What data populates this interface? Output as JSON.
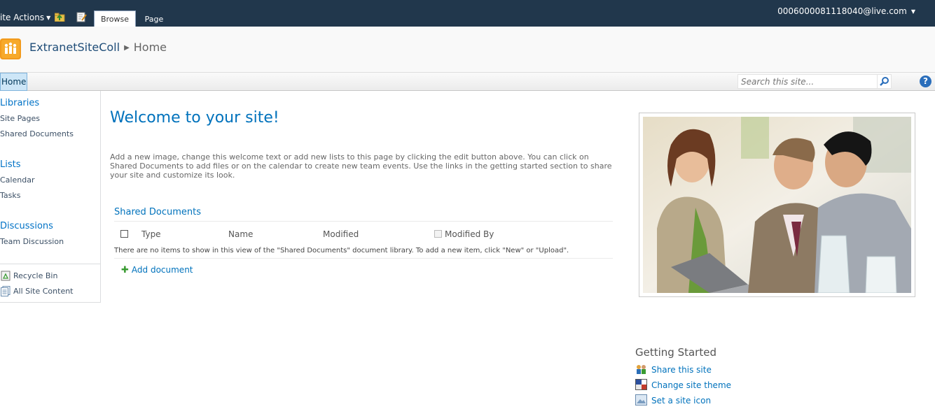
{
  "ribbon": {
    "site_actions": "ite Actions",
    "tabs": [
      "Browse",
      "Page"
    ],
    "user": "0006000081118040@live.com"
  },
  "title_area": {
    "site_title": "ExtranetSiteColl",
    "current_page": "Home"
  },
  "topnav": {
    "home": "Home",
    "search_placeholder": "Search this site...",
    "help": "?"
  },
  "quick_launch": {
    "libraries_heading": "Libraries",
    "libraries": [
      "Site Pages",
      "Shared Documents"
    ],
    "lists_heading": "Lists",
    "lists": [
      "Calendar",
      "Tasks"
    ],
    "discussions_heading": "Discussions",
    "discussions": [
      "Team Discussion"
    ],
    "recycle_bin": "Recycle Bin",
    "all_site_content": "All Site Content"
  },
  "main": {
    "welcome_title": "Welcome to your site!",
    "welcome_text": "Add a new image, change this welcome text or add new lists to this page by clicking the edit button above. You can click on Shared Documents to add files or on the calendar to create new team events. Use the links in the getting started section to share your site and customize its look.",
    "webpart_title": "Shared Documents",
    "columns": [
      "Type",
      "Name",
      "Modified",
      "Modified By"
    ],
    "empty_message": "There are no items to show in this view of the \"Shared Documents\" document library. To add a new item, click \"New\" or \"Upload\".",
    "add_document": "Add document"
  },
  "getting_started": {
    "title": "Getting Started",
    "links": [
      "Share this site",
      "Change site theme",
      "Set a site icon"
    ]
  },
  "colors": {
    "ribbon_bg": "#21374c",
    "link_blue": "#0072bc",
    "nav_selected": "#cde6f7"
  },
  "icons": {
    "navigate_up": "folder-up-icon",
    "edit_page": "edit-page-icon",
    "site_logo": "people-logo-icon",
    "search": "magnifier-icon",
    "help": "help-icon",
    "recycle_bin": "recycle-bin-icon",
    "all_site_content": "site-content-icon",
    "share_site": "share-site-icon",
    "change_theme": "theme-icon",
    "site_icon": "image-icon"
  }
}
